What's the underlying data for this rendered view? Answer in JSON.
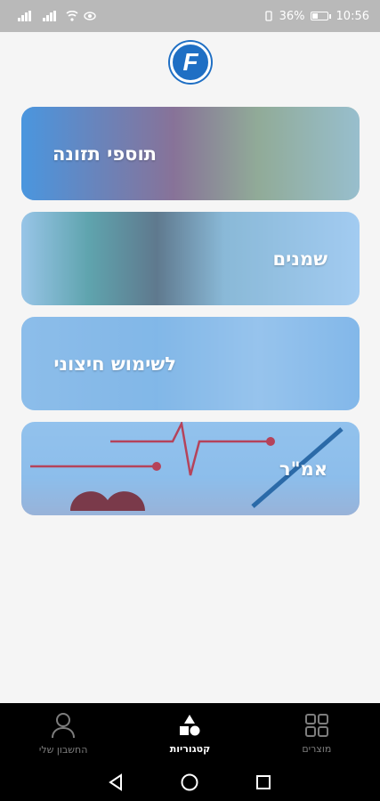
{
  "status_bar": {
    "battery": "36%",
    "time": "10:56"
  },
  "logo": {
    "letter": "F",
    "color": "#1f6fc4"
  },
  "categories": [
    {
      "label": "תוספי תזונה"
    },
    {
      "label": "שמנים"
    },
    {
      "label": "לשימוש חיצוני"
    },
    {
      "label": "אמ\"ר"
    }
  ],
  "bottom_nav": {
    "my_account": "החשבון שלי",
    "categories": "קטגוריות",
    "products": "מוצרים"
  },
  "colors": {
    "overlay": "#55a0e6",
    "nav_bg": "#000000",
    "active": "#ffffff",
    "inactive": "#7d7d7d"
  }
}
